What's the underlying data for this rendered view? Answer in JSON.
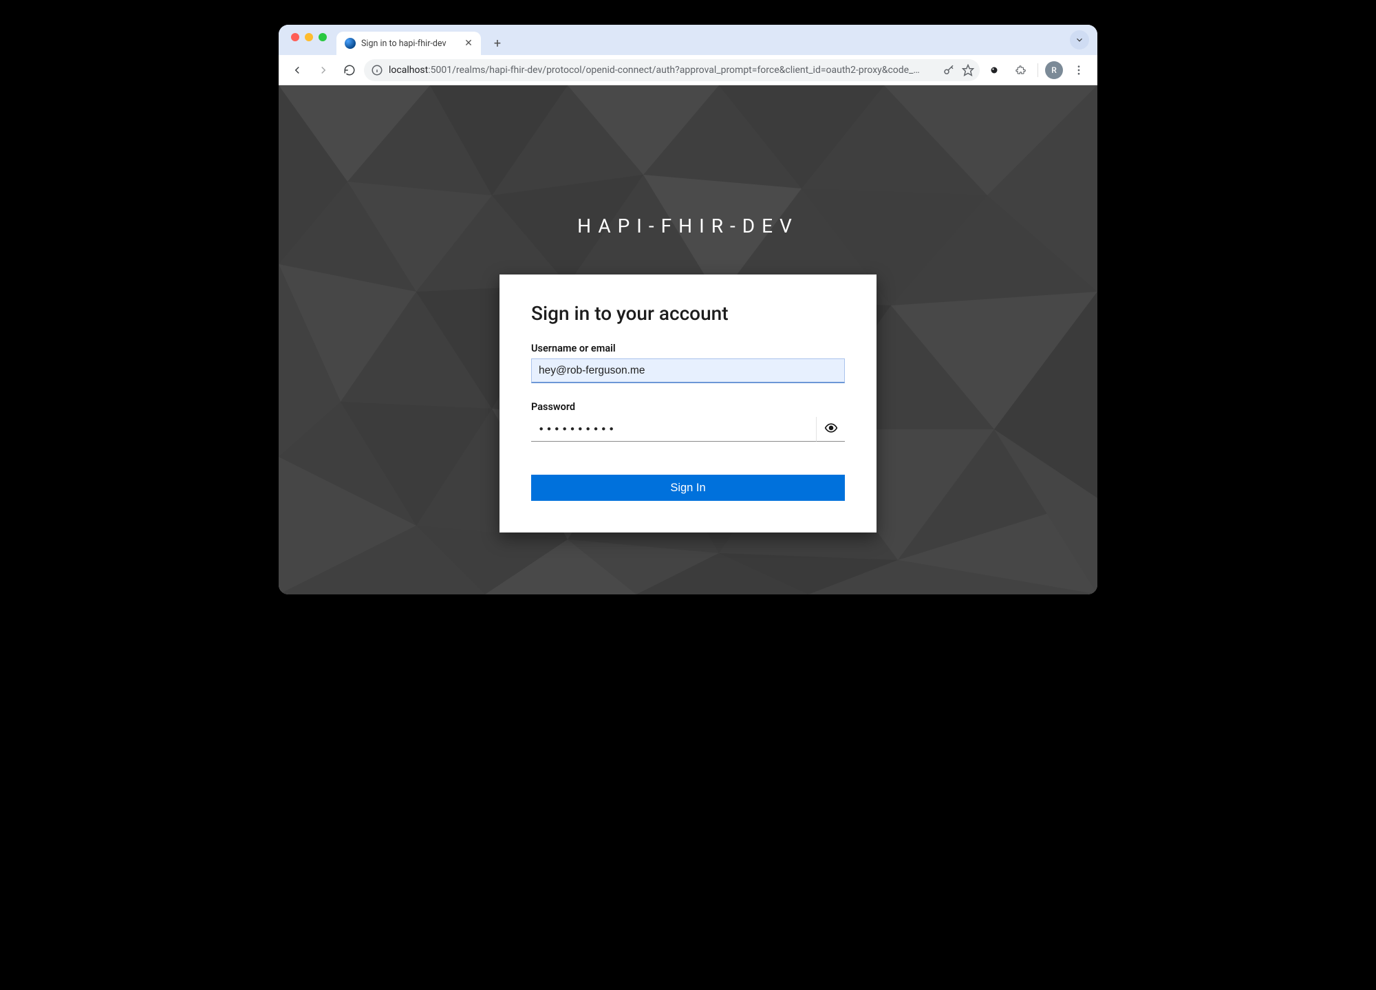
{
  "browser": {
    "tab_title": "Sign in to hapi-fhir-dev",
    "url_host": "localhost",
    "url_path": ":5001/realms/hapi-fhir-dev/protocol/openid-connect/auth?approval_prompt=force&client_id=oauth2-proxy&code_…",
    "avatar_initial": "R"
  },
  "page": {
    "realm_title": "HAPI-FHIR-DEV",
    "card_heading": "Sign in to your account",
    "username_label": "Username or email",
    "username_value": "hey@rob-ferguson.me",
    "password_label": "Password",
    "password_value": "••••••••••",
    "signin_label": "Sign In"
  }
}
